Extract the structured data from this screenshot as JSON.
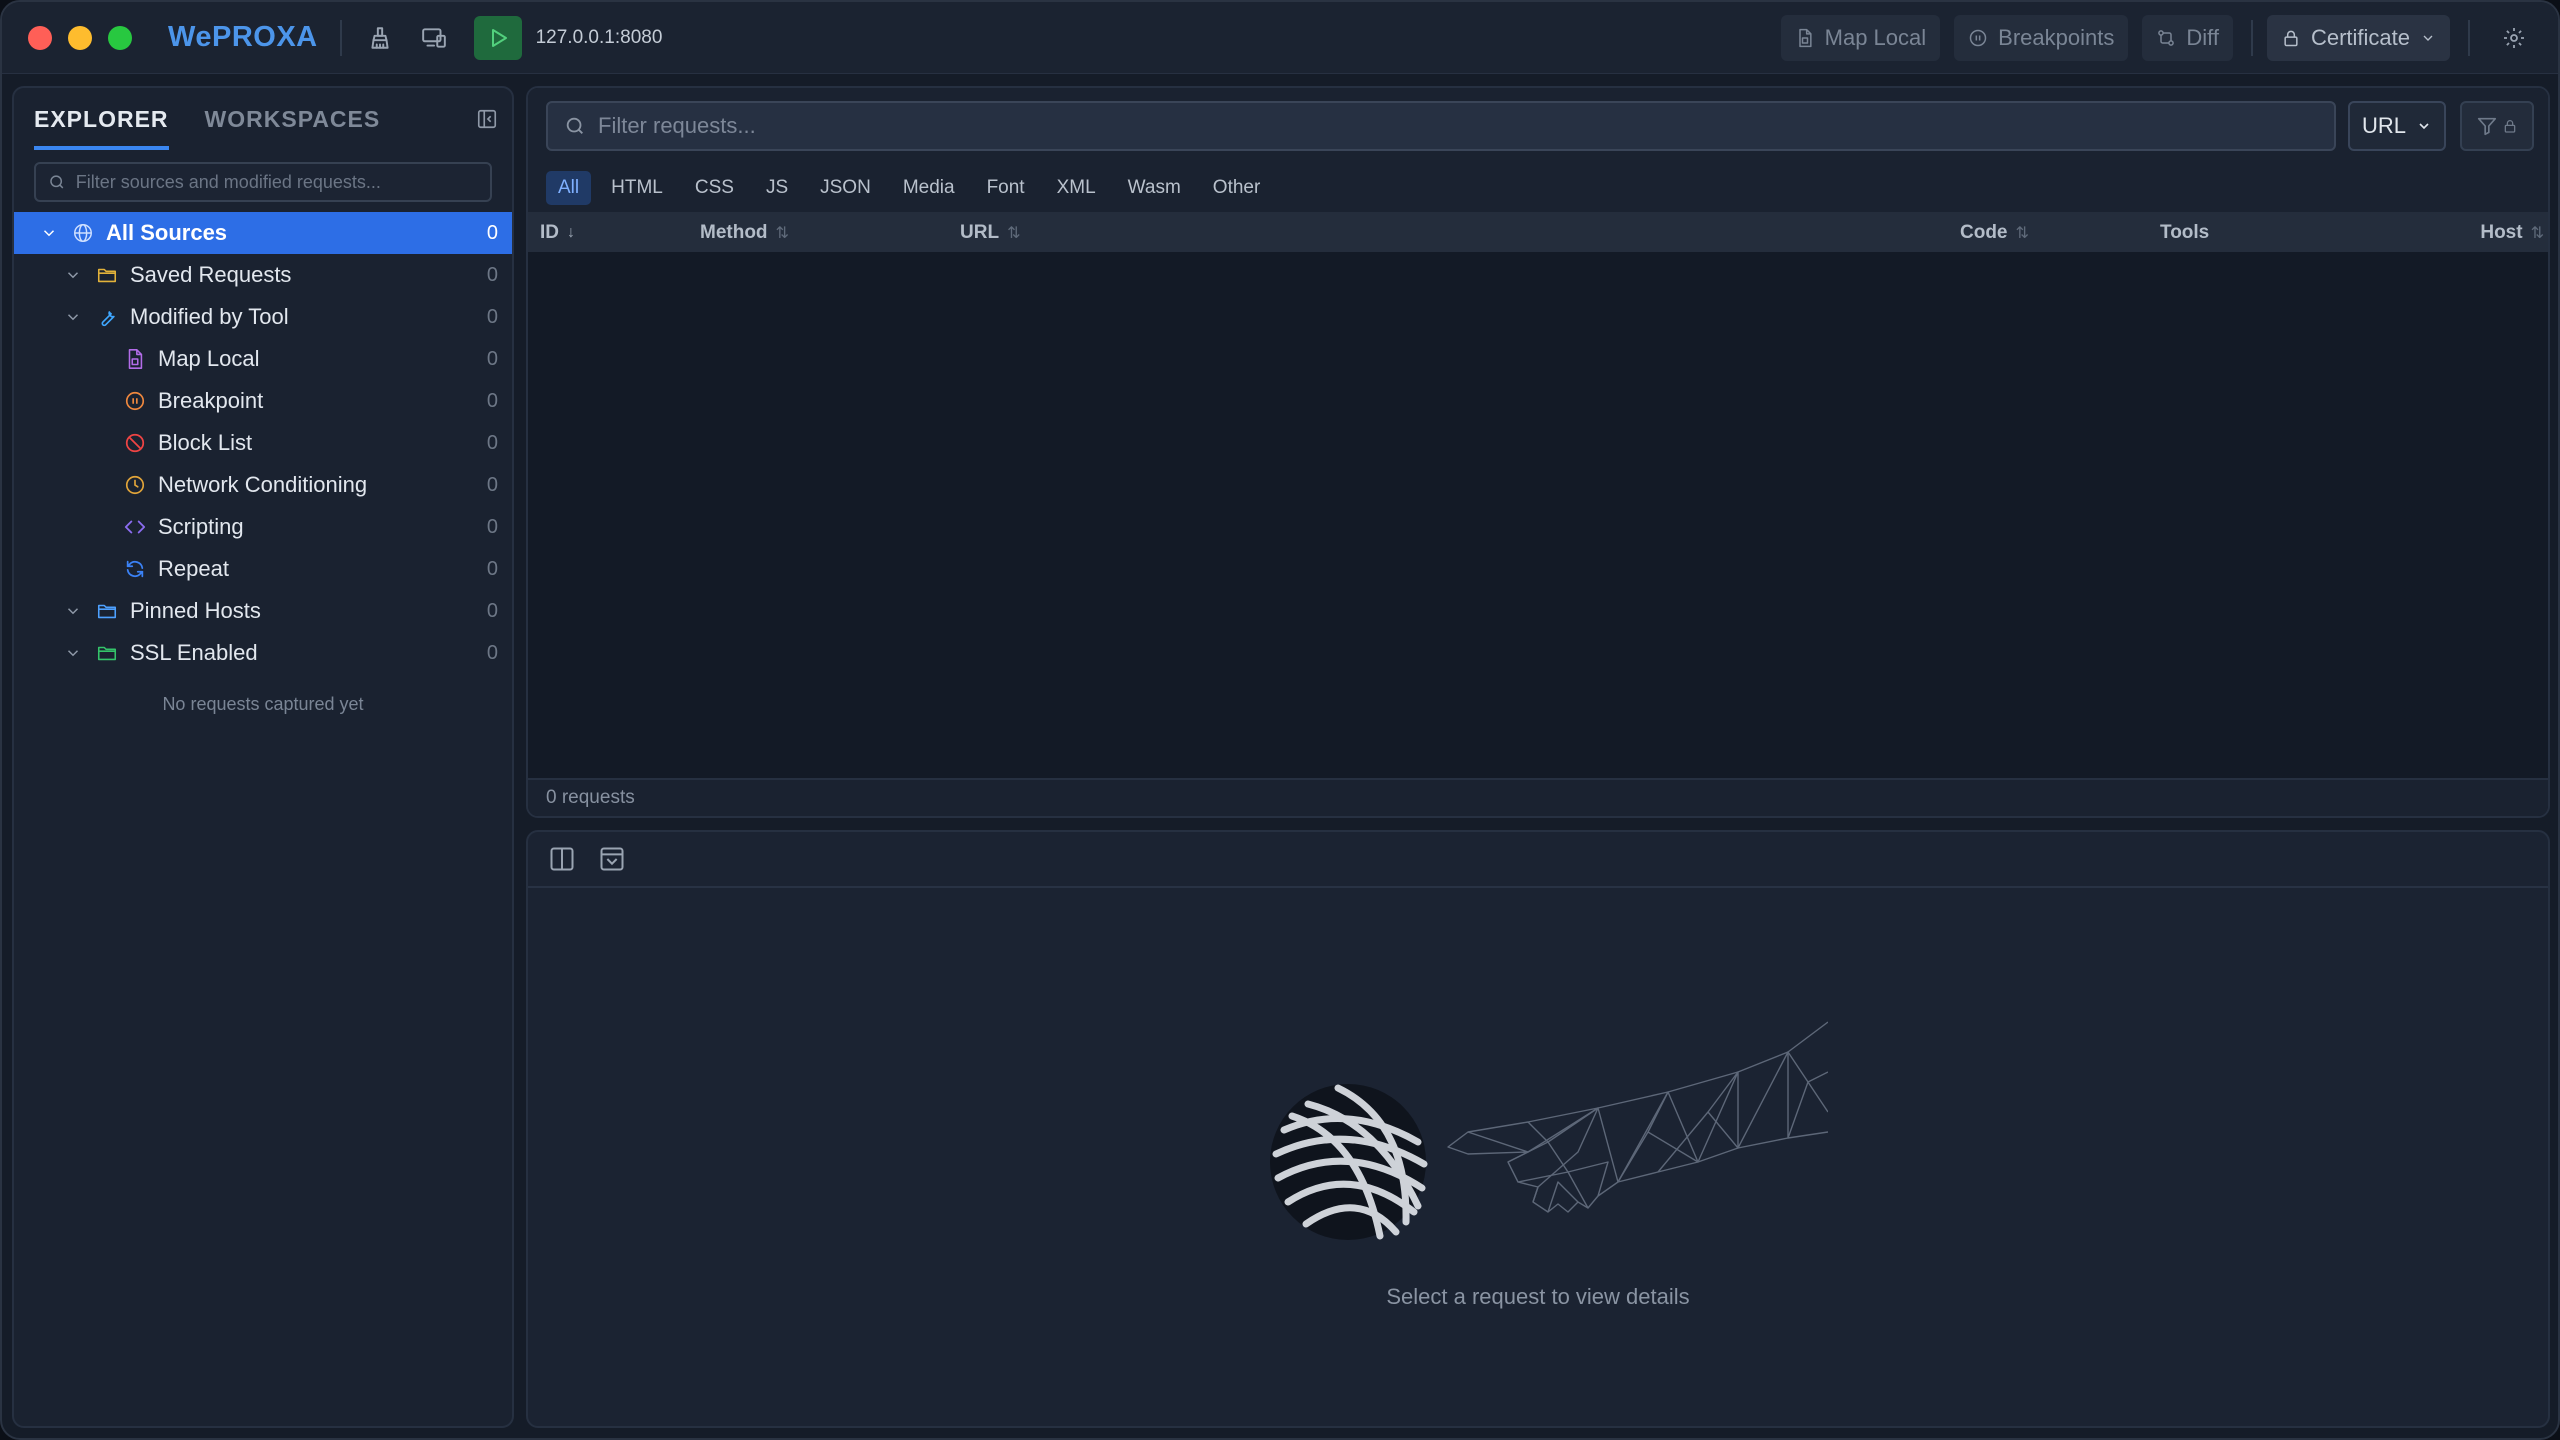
{
  "app": {
    "brand": "WePROXA",
    "proxy_address": "127.0.0.1:8080"
  },
  "toolbar": {
    "map_local_label": "Map Local",
    "breakpoints_label": "Breakpoints",
    "diff_label": "Diff",
    "certificate_label": "Certificate"
  },
  "sidebar": {
    "tabs": [
      {
        "label": "EXPLORER",
        "active": true
      },
      {
        "label": "WORKSPACES",
        "active": false
      }
    ],
    "search_placeholder": "Filter sources and modified requests...",
    "tree": [
      {
        "label": "All Sources",
        "count": "0",
        "icon": "globe-icon"
      },
      {
        "label": "Saved Requests",
        "count": "0",
        "icon": "folder-icon"
      },
      {
        "label": "Modified by Tool",
        "count": "0",
        "icon": "wrench-icon"
      },
      {
        "label": "Map Local",
        "count": "0",
        "icon": "file-icon"
      },
      {
        "label": "Breakpoint",
        "count": "0",
        "icon": "pause-circle-icon"
      },
      {
        "label": "Block List",
        "count": "0",
        "icon": "block-icon"
      },
      {
        "label": "Network Conditioning",
        "count": "0",
        "icon": "clock-icon"
      },
      {
        "label": "Scripting",
        "count": "0",
        "icon": "code-icon"
      },
      {
        "label": "Repeat",
        "count": "0",
        "icon": "repeat-icon"
      },
      {
        "label": "Pinned Hosts",
        "count": "0",
        "icon": "folder-icon"
      },
      {
        "label": "SSL Enabled",
        "count": "0",
        "icon": "folder-icon"
      }
    ],
    "empty_note": "No requests captured yet"
  },
  "requests": {
    "search_placeholder": "Filter requests...",
    "filter_field": "URL",
    "type_tabs": [
      "All",
      "HTML",
      "CSS",
      "JS",
      "JSON",
      "Media",
      "Font",
      "XML",
      "Wasm",
      "Other"
    ],
    "columns": [
      "ID",
      "Method",
      "URL",
      "Code",
      "Tools",
      "Host"
    ],
    "status": "0 requests"
  },
  "detail": {
    "hint": "Select a request to view details"
  },
  "colors": {
    "accent": "#2d6ee6",
    "brand": "#4c95ea",
    "play": "#1f6a3d"
  }
}
